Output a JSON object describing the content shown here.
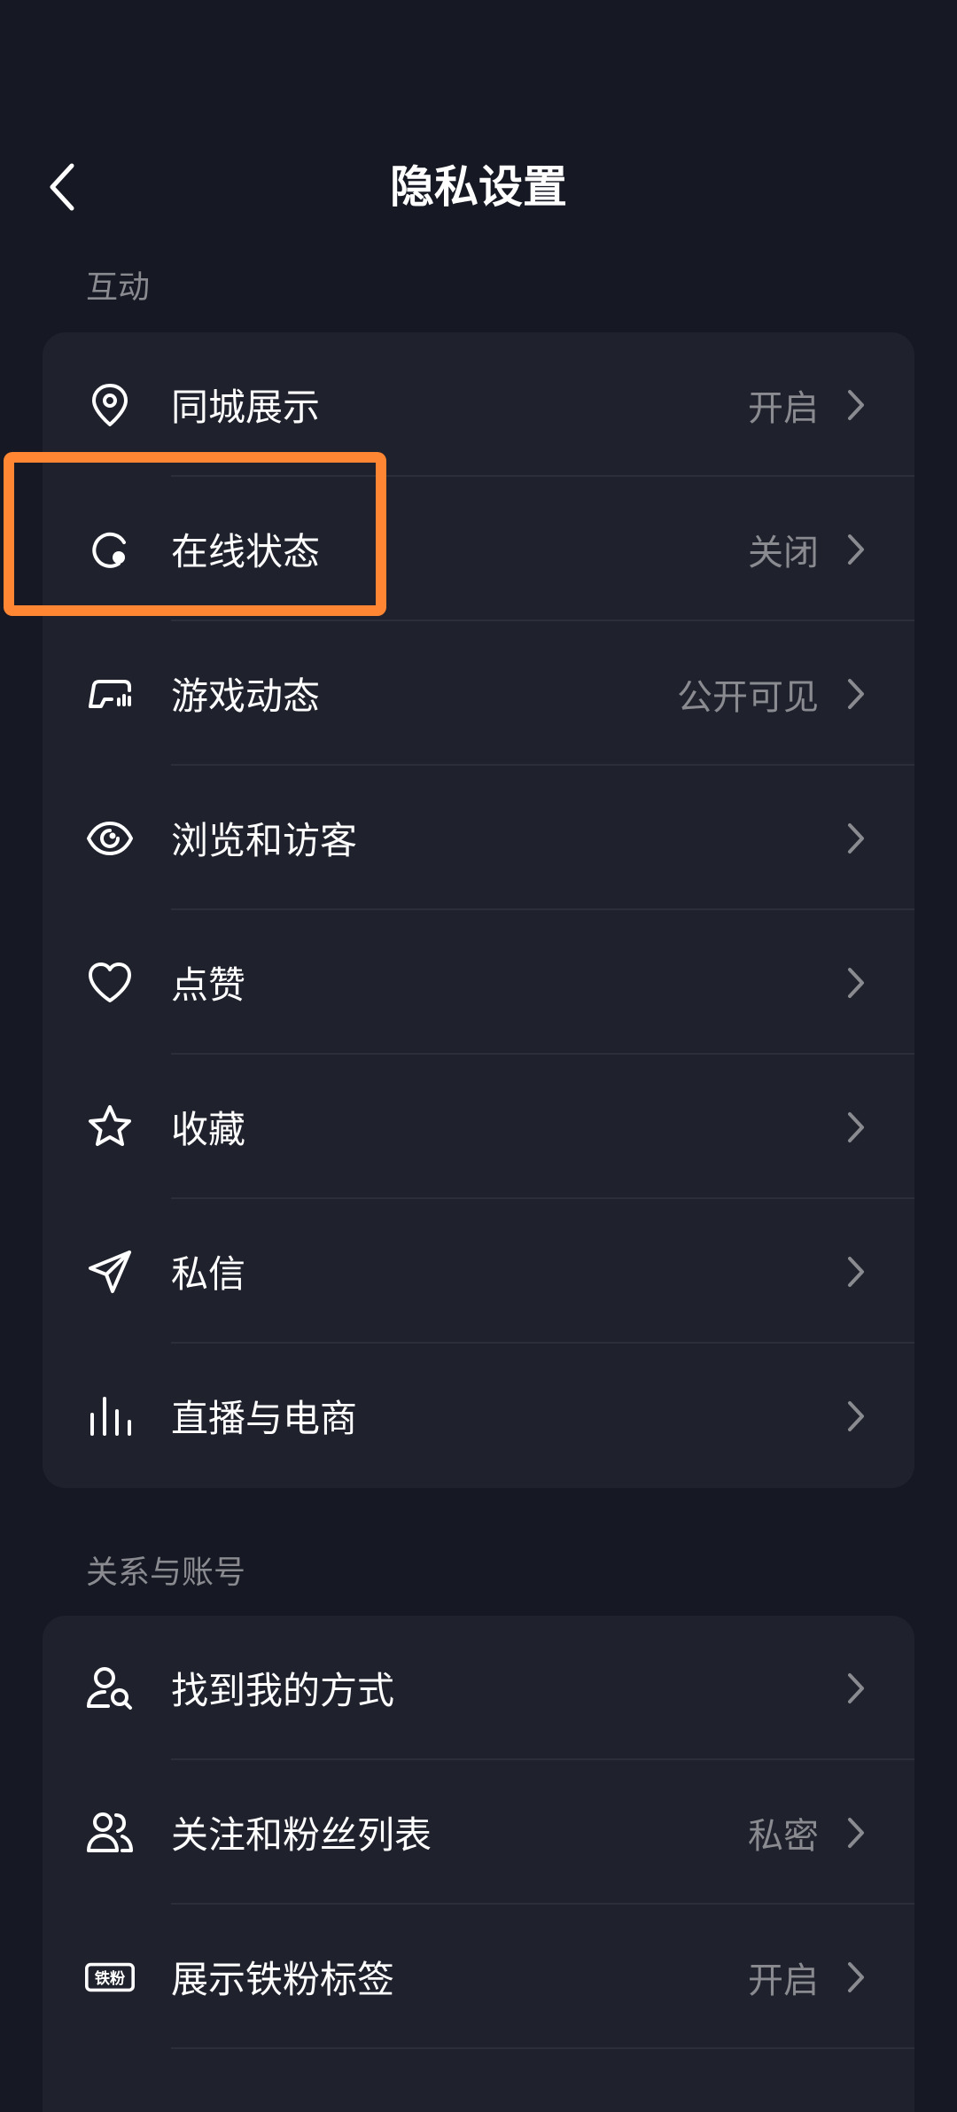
{
  "header": {
    "title": "隐私设置"
  },
  "sections": [
    {
      "title": "互动",
      "items": [
        {
          "label": "同城展示",
          "value": "开启",
          "icon": "location-pin-icon"
        },
        {
          "label": "在线状态",
          "value": "关闭",
          "icon": "online-status-icon"
        },
        {
          "label": "游戏动态",
          "value": "公开可见",
          "icon": "game-controller-icon"
        },
        {
          "label": "浏览和访客",
          "value": "",
          "icon": "eye-icon"
        },
        {
          "label": "点赞",
          "value": "",
          "icon": "heart-icon"
        },
        {
          "label": "收藏",
          "value": "",
          "icon": "star-icon"
        },
        {
          "label": "私信",
          "value": "",
          "icon": "paper-plane-icon"
        },
        {
          "label": "直播与电商",
          "value": "",
          "icon": "live-bars-icon"
        }
      ]
    },
    {
      "title": "关系与账号",
      "items": [
        {
          "label": "找到我的方式",
          "value": "",
          "icon": "find-user-icon"
        },
        {
          "label": "关注和粉丝列表",
          "value": "私密",
          "icon": "users-icon"
        },
        {
          "label": "展示铁粉标签",
          "value": "开启",
          "icon": "iron-fan-badge-icon"
        }
      ]
    }
  ],
  "badge_icon_text": "铁粉",
  "colors": {
    "background": "#161823",
    "card": "#1f212c",
    "divider": "#2c2e39",
    "secondary_text": "#8a8b91",
    "highlight": "#ff8633"
  }
}
